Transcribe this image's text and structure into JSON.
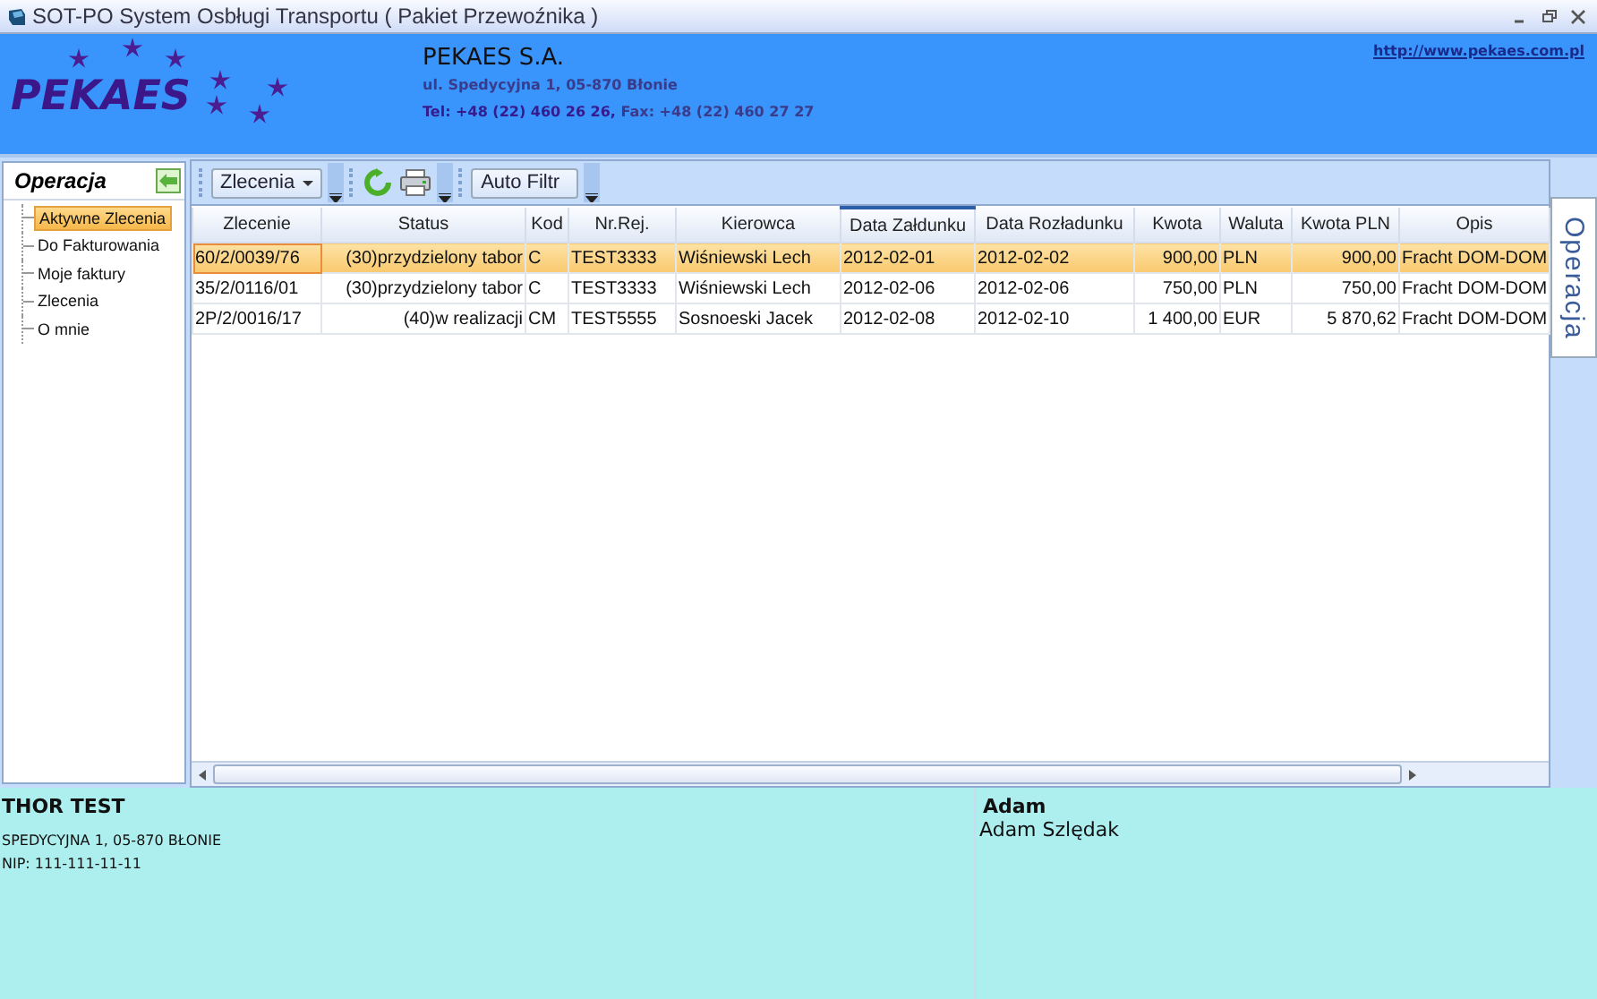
{
  "window": {
    "title": "SOT-PO System Osbługi Transportu   ( Pakiet Przewoźnika )"
  },
  "header": {
    "logo": "PEKAES",
    "company": "PEKAES S.A.",
    "address": "ul. Spedycyjna 1, 05-870  Błonie",
    "phone": "Tel: +48  (22) 460  26  26,",
    "fax": " Fax: +48  (22) 460  27  27",
    "link": "http://www.pekaes.com.pl"
  },
  "sidebar": {
    "title": "Operacja",
    "items": [
      {
        "label": "Aktywne Zlecenia",
        "selected": true
      },
      {
        "label": "Do Fakturowania",
        "selected": false
      },
      {
        "label": "Moje faktury",
        "selected": false
      },
      {
        "label": "Zlecenia",
        "selected": false
      },
      {
        "label": "O mnie",
        "selected": false
      }
    ]
  },
  "toolbar": {
    "dropdown": "Zlecenia",
    "filter_button": "Auto Filtr"
  },
  "table": {
    "columns": [
      {
        "label": "Zlecenie",
        "sorted": false
      },
      {
        "label": "Status",
        "sorted": false
      },
      {
        "label": "Kod",
        "sorted": false
      },
      {
        "label": "Nr.Rej.",
        "sorted": false
      },
      {
        "label": "Kierowca",
        "sorted": false
      },
      {
        "label": "Data Załdunku",
        "sorted": true
      },
      {
        "label": "Data Rozładunku",
        "sorted": false
      },
      {
        "label": "Kwota",
        "sorted": false
      },
      {
        "label": "Waluta",
        "sorted": false
      },
      {
        "label": "Kwota PLN",
        "sorted": false
      },
      {
        "label": "Opis",
        "sorted": false
      }
    ],
    "rows": [
      {
        "selected": true,
        "cells": [
          "60/2/0039/76",
          "(30)przydzielony tabor",
          "C",
          "TEST3333",
          "Wiśniewski Lech",
          "2012-02-01",
          "2012-02-02",
          "900,00",
          "PLN",
          "900,00",
          "Fracht DOM-DOM"
        ]
      },
      {
        "selected": false,
        "cells": [
          "35/2/0116/01",
          "(30)przydzielony tabor",
          "C",
          "TEST3333",
          "Wiśniewski Lech",
          "2012-02-06",
          "2012-02-06",
          "750,00",
          "PLN",
          "750,00",
          "Fracht DOM-DOM"
        ]
      },
      {
        "selected": false,
        "cells": [
          "2P/2/0016/17",
          "(40)w realizacji",
          "CM",
          "TEST5555",
          "Sosnoeski Jacek",
          "2012-02-08",
          "2012-02-10",
          "1 400,00",
          "EUR",
          "5 870,62",
          "Fracht DOM-DOM"
        ]
      }
    ]
  },
  "side_tab": {
    "label": "Operacja"
  },
  "footer": {
    "left": {
      "name": "THOR TEST",
      "address": "SPEDYCYJNA  1, 05-870  BŁONIE",
      "nip": "NIP: 111-111-11-11"
    },
    "right": {
      "title": "Adam",
      "person": "Adam Szlędak"
    }
  }
}
